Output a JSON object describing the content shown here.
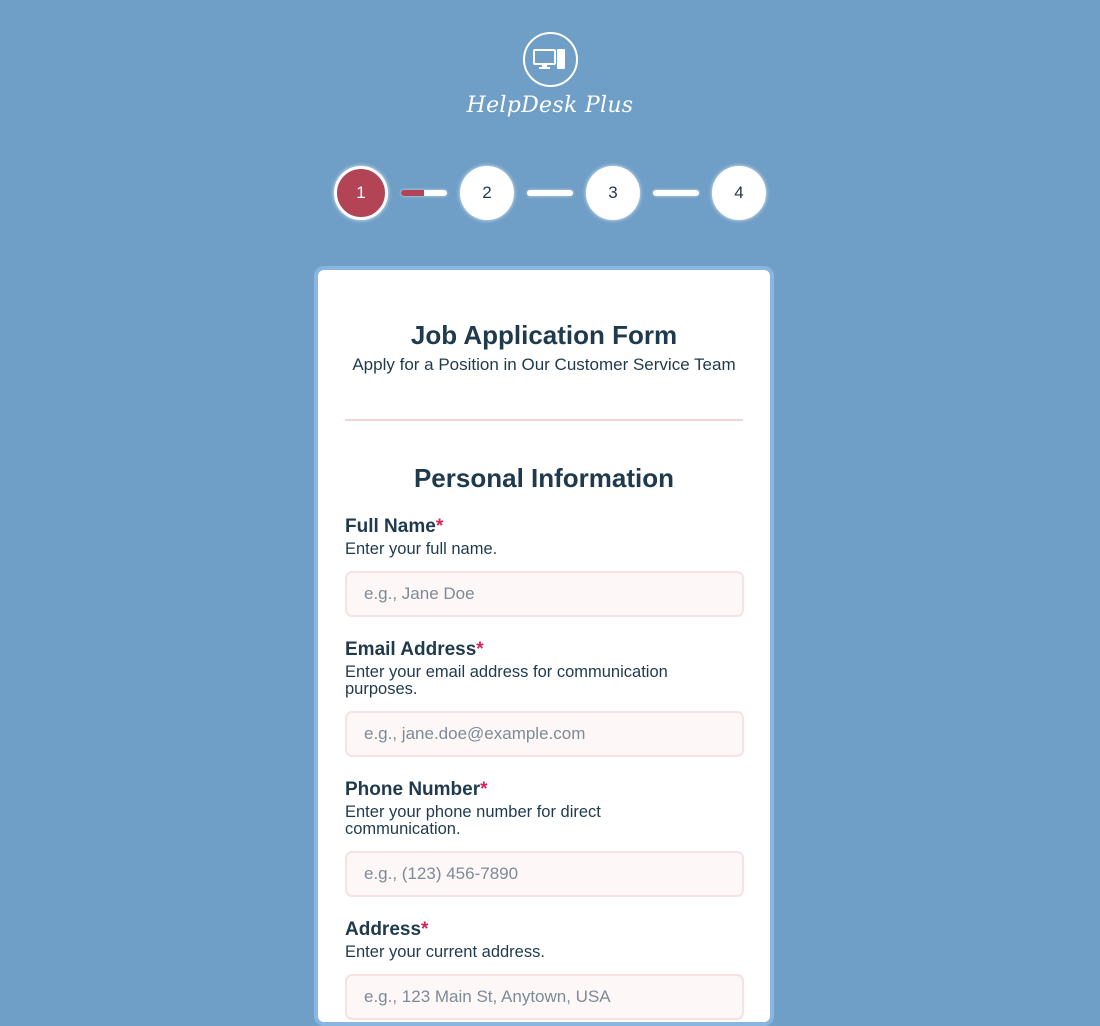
{
  "brand": {
    "name": "HelpDesk Plus",
    "logo_icon": "computer-monitor-icon"
  },
  "stepper": {
    "steps": [
      {
        "label": "1",
        "state": "active"
      },
      {
        "label": "2",
        "state": "pending"
      },
      {
        "label": "3",
        "state": "pending"
      },
      {
        "label": "4",
        "state": "pending"
      }
    ],
    "connector_progress": [
      0.5,
      0,
      0
    ],
    "active_color": "#b24456"
  },
  "form": {
    "title": "Job Application Form",
    "subtitle": "Apply for a Position in Our Customer Service Team",
    "section_title": "Personal Information",
    "required_marker": "*",
    "fields": [
      {
        "label": "Full Name",
        "help": "Enter your full name.",
        "placeholder": "e.g., Jane Doe",
        "value": ""
      },
      {
        "label": "Email Address",
        "help": "Enter your email address for communication purposes.",
        "placeholder": "e.g., jane.doe@example.com",
        "value": ""
      },
      {
        "label": "Phone Number",
        "help": "Enter your phone number for direct communication.",
        "placeholder": "e.g., (123) 456-7890",
        "value": ""
      },
      {
        "label": "Address",
        "help": "Enter your current address.",
        "placeholder": "e.g., 123 Main St, Anytown, USA",
        "value": ""
      }
    ]
  },
  "colors": {
    "background": "#6f9ec6",
    "accent": "#b24456",
    "required": "#d6245a",
    "text": "#1f3a4d"
  }
}
